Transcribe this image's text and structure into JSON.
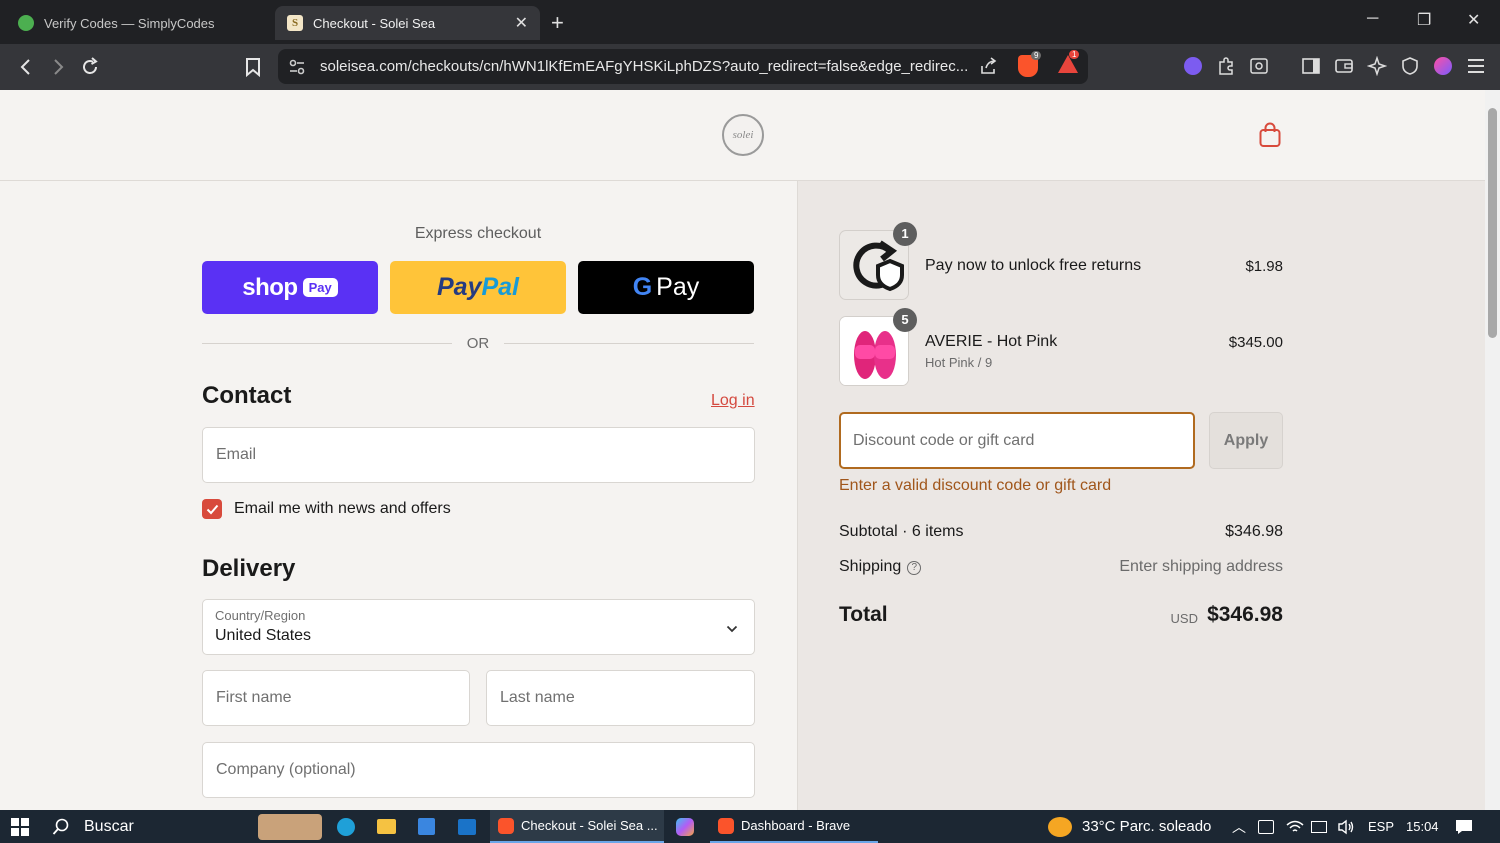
{
  "browser": {
    "tabs": [
      {
        "title": "Verify Codes — SimplyCodes",
        "active": false
      },
      {
        "title": "Checkout - Solei Sea",
        "active": true
      }
    ],
    "url": "soleisea.com/checkouts/cn/hWN1lKfEmEAFgYHSKiLphDZS?auto_redirect=false&edge_redirec...",
    "shields_count": "9",
    "alerts_count": "1"
  },
  "header": {
    "logo_text": "solei"
  },
  "express": {
    "title": "Express checkout",
    "shop_word": "shop",
    "shop_pill": "Pay",
    "paypal_a": "Pay",
    "paypal_b": "Pal",
    "gpay_g": "G",
    "gpay_word": "Pay",
    "or": "OR"
  },
  "contact": {
    "title": "Contact",
    "login": "Log in",
    "email_placeholder": "Email",
    "newsletter_label": "Email me with news and offers",
    "newsletter_checked": true
  },
  "delivery": {
    "title": "Delivery",
    "country_label": "Country/Region",
    "country_value": "United States",
    "first_name_placeholder": "First name",
    "last_name_placeholder": "Last name",
    "company_placeholder": "Company (optional)"
  },
  "order": {
    "items": [
      {
        "name": "Pay now to unlock free returns",
        "variant": "",
        "price": "$1.98",
        "qty": "1"
      },
      {
        "name": "AVERIE - Hot Pink",
        "variant": "Hot Pink / 9",
        "price": "$345.00",
        "qty": "5"
      }
    ],
    "discount_placeholder": "Discount code or gift card",
    "apply_label": "Apply",
    "discount_error": "Enter a valid discount code or gift card",
    "subtotal_label": "Subtotal · 6 items",
    "subtotal_value": "$346.98",
    "shipping_label": "Shipping",
    "shipping_value": "Enter shipping address",
    "total_label": "Total",
    "total_currency": "USD",
    "total_value": "$346.98"
  },
  "colors": {
    "accent": "#d84a3c",
    "shop_pay": "#5a31f4",
    "paypal": "#ffc439",
    "discount_error": "#a0561b"
  },
  "taskbar": {
    "search": "Buscar",
    "apps": [
      {
        "label": "Checkout - Solei Sea ...",
        "active": true
      },
      {
        "label": "Dashboard - Brave",
        "active": false
      }
    ],
    "weather": "33°C  Parc. soleado",
    "lang": "ESP",
    "time": "15:04"
  }
}
